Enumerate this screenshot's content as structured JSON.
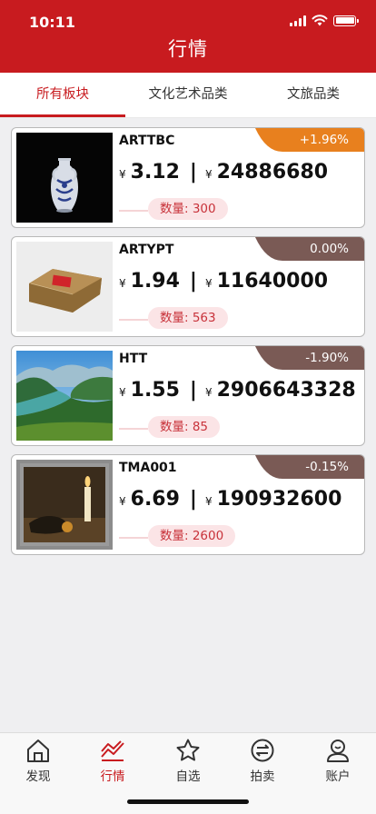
{
  "status_bar": {
    "time": "10:11"
  },
  "header": {
    "title": "行情"
  },
  "tabs": [
    {
      "label": "所有板块",
      "active": true
    },
    {
      "label": "文化艺术品类",
      "active": false
    },
    {
      "label": "文旅品类",
      "active": false
    }
  ],
  "currency_symbol": "¥",
  "items": [
    {
      "code": "ARTTBC",
      "price": "3.12",
      "amount": "24886680",
      "quantity": "数量: 300",
      "change": "+1.96%",
      "change_color": "#e8801e",
      "image": "vase-image"
    },
    {
      "code": "ARTYPT",
      "price": "1.94",
      "amount": "11640000",
      "quantity": "数量: 563",
      "change": "0.00%",
      "change_color": "#7a5a55",
      "image": "tea-brick-image"
    },
    {
      "code": "HTT",
      "price": "1.55",
      "amount": "2906643328",
      "quantity": "数量: 85",
      "change": "-1.90%",
      "change_color": "#7a5a55",
      "image": "landscape-image"
    },
    {
      "code": "TMA001",
      "price": "6.69",
      "amount": "190932600",
      "quantity": "数量: 2600",
      "change": "-0.15%",
      "change_color": "#7a5a55",
      "image": "still-life-painting-image"
    }
  ],
  "tabbar": [
    {
      "label": "发现",
      "icon": "home-icon",
      "active": false
    },
    {
      "label": "行情",
      "icon": "chart-icon",
      "active": true
    },
    {
      "label": "自选",
      "icon": "star-icon",
      "active": false
    },
    {
      "label": "拍卖",
      "icon": "exchange-icon",
      "active": false
    },
    {
      "label": "账户",
      "icon": "user-icon",
      "active": false
    }
  ]
}
